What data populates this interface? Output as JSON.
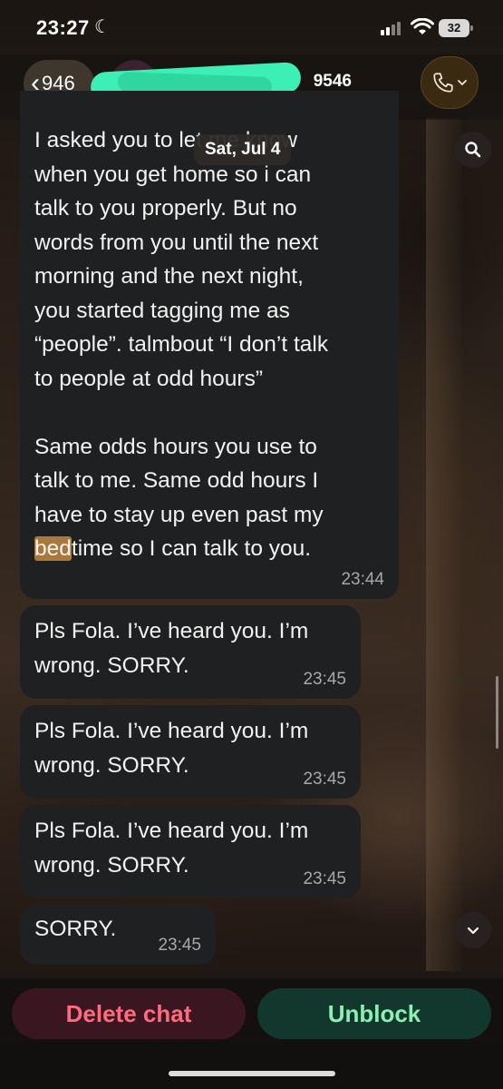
{
  "status_bar": {
    "time": "23:27",
    "battery": "32"
  },
  "header": {
    "back_count": "946",
    "contact_suffix": "9546"
  },
  "chat": {
    "date_badge": "Sat, Jul 4",
    "messages": [
      {
        "text_before_highlight": "I asked you to let me know\nwhen you get home so i can\ntalk to you properly. But no\nwords from you until the next\nmorning and the next night,\nyou started tagging me as\n“people”. talmbout “I don’t talk\nto people at odd hours”\n\nSame odds hours you use to\ntalk to me. Same odd hours I\nhave to stay up even past my\n",
        "highlight": "bed",
        "text_after_highlight": "time so I can talk to you.",
        "time": "23:44"
      },
      {
        "text": "Pls Fola. I’ve heard you. I’m\nwrong. SORRY.",
        "time": "23:45"
      },
      {
        "text": "Pls Fola. I’ve heard you. I’m\nwrong. SORRY.",
        "time": "23:45"
      },
      {
        "text": "Pls Fola. I’ve heard you. I’m\nwrong. SORRY.",
        "time": "23:45"
      },
      {
        "text": "SORRY.",
        "time": "23:45"
      }
    ]
  },
  "actions": {
    "delete_label": "Delete chat",
    "unblock_label": "Unblock"
  },
  "colors": {
    "bubble": "#1f2021",
    "delete_text": "#ff6b7d",
    "unblock_text": "#8cf0b4",
    "highlight": "#a9783a",
    "redaction": "#3cefb4"
  }
}
